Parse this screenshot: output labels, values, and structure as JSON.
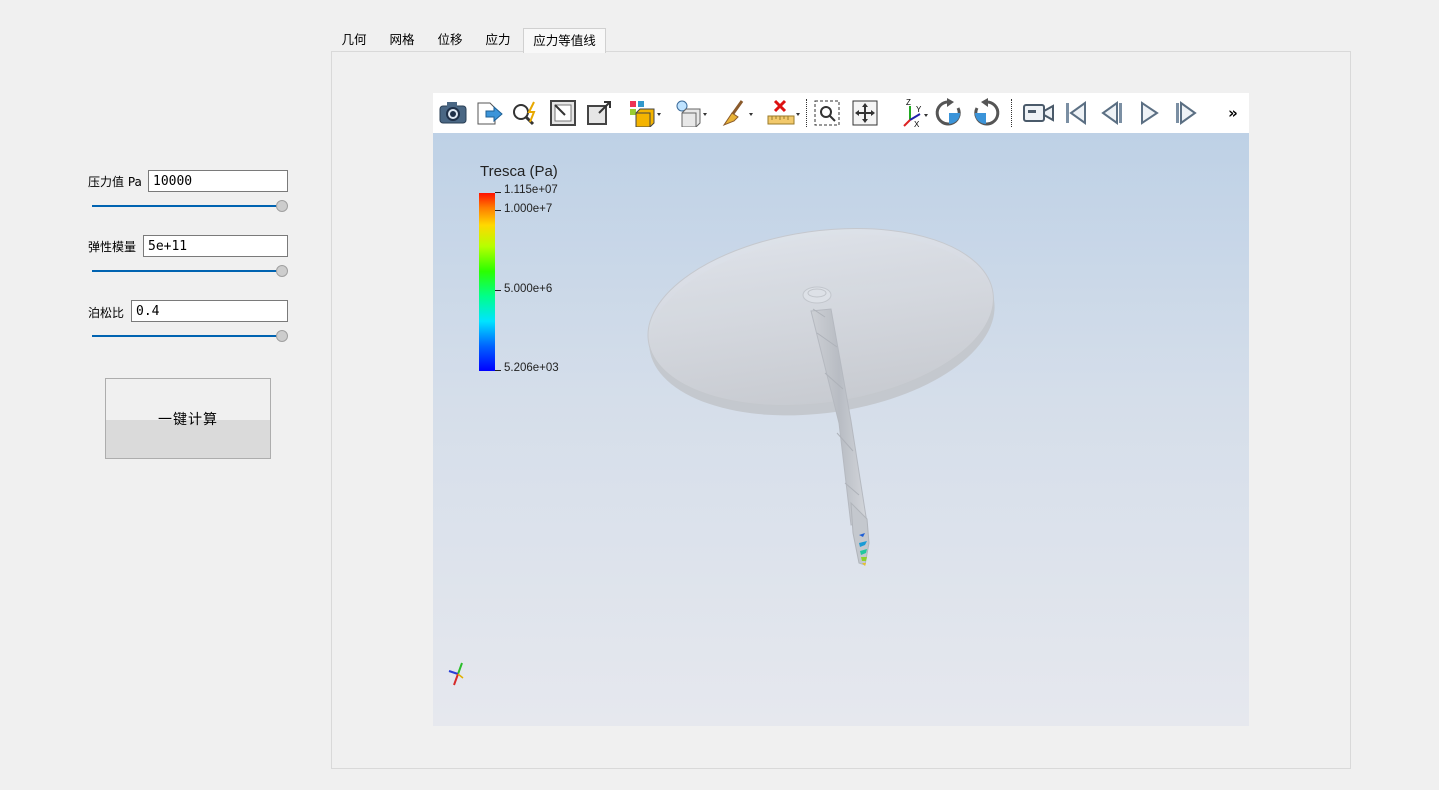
{
  "params": [
    {
      "label": "压力值 Pa",
      "value": "10000",
      "slider_value": 1.0
    },
    {
      "label": "弹性模量",
      "value": "5e+11",
      "slider_value": 1.0
    },
    {
      "label": "泊松比",
      "value": "0.4",
      "slider_value": 1.0
    }
  ],
  "calc_button": "一键计算",
  "tabs": [
    {
      "label": "几何",
      "active": false
    },
    {
      "label": "网格",
      "active": false
    },
    {
      "label": "位移",
      "active": false
    },
    {
      "label": "应力",
      "active": false
    },
    {
      "label": "应力等值线",
      "active": true
    }
  ],
  "toolbar": {
    "icons": [
      "camera-icon",
      "export-icon",
      "find-data-icon",
      "reset-camera-icon",
      "zoom-to-data-icon",
      "representation-icon",
      "light-icon",
      "clear-icon",
      "ruler-icon",
      "zoom-box-icon",
      "pan-icon",
      "axes-orientation-icon",
      "rotate-cw-icon",
      "rotate-ccw-icon",
      "camera-record-icon",
      "first-frame-icon",
      "previous-frame-icon",
      "play-icon",
      "next-frame-icon"
    ],
    "overflow": "»"
  },
  "legend": {
    "title": "Tresca (Pa)",
    "ticks": [
      "1.115e+07",
      "1.000e+7",
      "5.000e+6",
      "5.206e+03"
    ],
    "max": 11150000,
    "min": 5206,
    "tick_values": [
      11150000,
      10000000,
      5000000,
      5206
    ]
  },
  "colors": {
    "accent": "#0063b1",
    "render_top": "#bed1e6",
    "render_bottom": "#e6e8ee"
  }
}
